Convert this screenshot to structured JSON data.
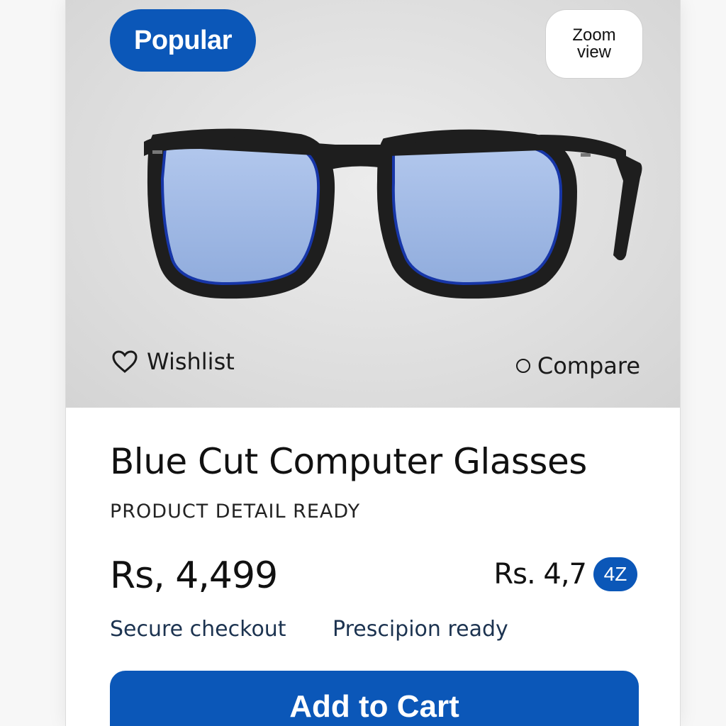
{
  "product": {
    "badge": "Popular",
    "zoom_label": "Zoom view",
    "wishlist_label": "Wishlist",
    "compare_label": "Compare",
    "title": "Blue Cut Computer Glasses",
    "subtitle": "PRODUCT DETAIL READY",
    "price": "Rs, 4,499",
    "alt_price": "Rs. 4,7",
    "alt_price_badge": "4Z",
    "features": [
      "Secure checkout",
      "Prescipion ready"
    ],
    "cta_label": "Add to Cart"
  },
  "icons": {
    "wishlist": "heart-icon",
    "compare": "radio-circle-icon"
  },
  "colors": {
    "accent": "#0b57b8",
    "lens": "#9db7e6",
    "frame": "#1e1e1e",
    "hero_bg": "#dedede"
  }
}
